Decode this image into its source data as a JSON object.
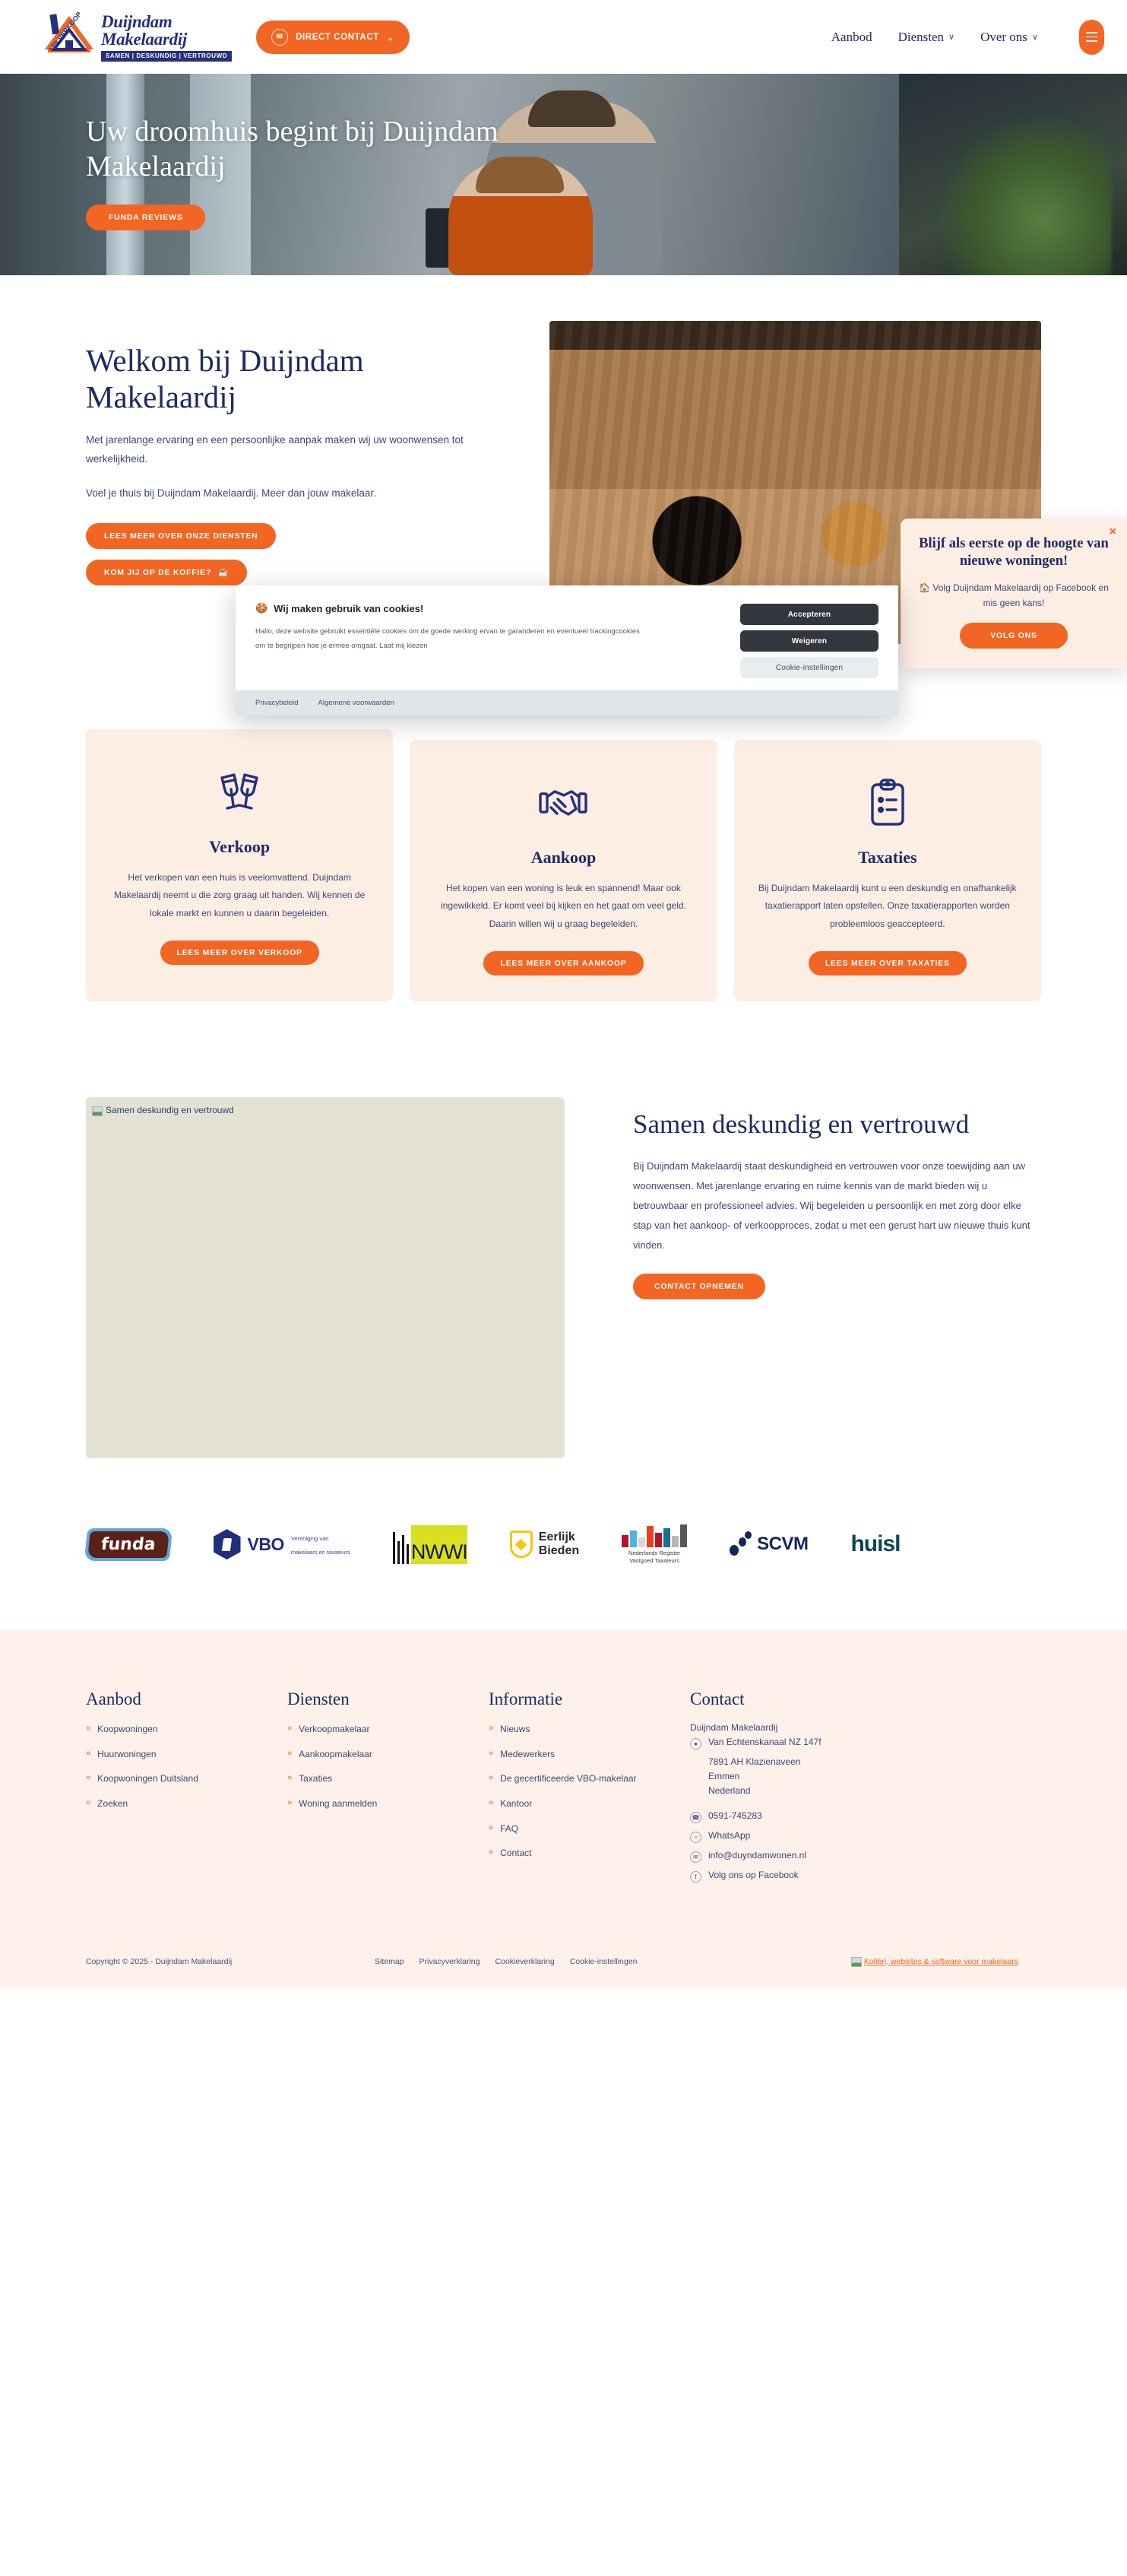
{
  "header": {
    "logo": {
      "line1": "Duijndam",
      "line2": "Makelaardij",
      "tagline": "SAMEN  |  DESKUNDIG  |  VERTROUWD",
      "badge": "UW VERKOOP"
    },
    "direct_contact": "DIRECT CONTACT",
    "direct_contact_icon": "envelope-icon",
    "nav": [
      {
        "label": "Aanbod",
        "caret": ""
      },
      {
        "label": "Diensten",
        "caret": "∨"
      },
      {
        "label": "Over ons",
        "caret": "∨"
      }
    ],
    "menu_icon": "hamburger-menu-icon"
  },
  "hero": {
    "title": "Uw droomhuis begint bij Duijndam Makelaardij",
    "cta": "FUNDA REVIEWS"
  },
  "welkom": {
    "title": "Welkom bij Duijndam Makelaardij",
    "paragraph1": "Met jarenlange ervaring en een persoonlijke aanpak maken wij uw woonwensen tot werkelijkheid.",
    "paragraph2": "Voel je thuis bij Duijndam Makelaardij. Meer dan jouw makelaar.",
    "btn_diensten": "LEES MEER OVER ONZE DIENSTEN",
    "btn_koffie": "KOM JIJ OP DE KOFFIE?",
    "btn_koffie_icon": "coffee-cup-icon"
  },
  "cookie": {
    "icon": "cookie-icon",
    "title": "Wij maken gebruik van cookies!",
    "body": "Hallo, deze website gebruikt essentiële cookies om de goede werking ervan te garanderen en eventueel trackingcookies om te begrijpen hoe je ermee omgaat. Laat mij kiezen",
    "accept": "Accepteren",
    "refuse": "Weigeren",
    "settings": "Cookie-instellingen",
    "links": [
      "Privacybeleid",
      "Algemene voorwaarden"
    ]
  },
  "fbpop": {
    "close_icon": "close-icon",
    "title": "Blijf als eerste op de hoogte van nieuwe woningen!",
    "house_icon": "house-icon",
    "body": "Volg Duijndam Makelaardij op Facebook en mis geen kans!",
    "cta": "VOLG ONS"
  },
  "cards": [
    {
      "icon": "champagne-glasses-icon",
      "title": "Verkoop",
      "body": "Het verkopen van een huis is veelomvattend. Duijndam Makelaardij neemt u die zorg graag uit handen. Wij kennen de lokale markt en kunnen u daarin begeleiden.",
      "cta": "LEES MEER OVER VERKOOP"
    },
    {
      "icon": "handshake-icon",
      "title": "Aankoop",
      "body": "Het kopen van een woning is leuk en spannend! Maar ook ingewikkeld. Er komt veel bij kijken en het gaat om veel geld. Daarin willen wij u graag begeleiden.",
      "cta": "LEES MEER OVER AANKOOP"
    },
    {
      "icon": "clipboard-list-icon",
      "title": "Taxaties",
      "body": "Bij Duijndam Makelaardij kunt u een deskundig en onafhankelijk taxatierapport laten opstellen. Onze taxatierapporten worden probleemloos geaccepteerd.",
      "cta": "LEES MEER OVER TAXATIES"
    }
  ],
  "samen": {
    "image_alt": "Samen deskundig en vertrouwd",
    "title": "Samen deskundig en vertrouwd",
    "body": "Bij Duijndam Makelaardij staat deskundigheid en vertrouwen voor onze toewijding aan uw woonwensen. Met jarenlange ervaring en ruime kennis van de markt bieden wij u betrouwbaar en professioneel advies. Wij begeleiden u persoonlijk en met zorg door elke stap van het aankoop- of verkoopproces, zodat u met een gerust hart uw nieuwe thuis kunt vinden.",
    "cta": "CONTACT OPNEMEN"
  },
  "partners": [
    {
      "name": "funda",
      "label": "funda"
    },
    {
      "name": "vbo",
      "label": "VBO",
      "sub1": "Vereniging van",
      "sub2": "makelaars en taxateurs"
    },
    {
      "name": "nwwi",
      "label": "NWWI"
    },
    {
      "name": "eerlijk-bieden",
      "line1": "Eerlijk",
      "line2": "Bieden"
    },
    {
      "name": "nrvt",
      "line1": "Nederlands Register",
      "line2": "Vastgoed  Taxateurs"
    },
    {
      "name": "scvm",
      "label": "SCVM"
    },
    {
      "name": "huislijn",
      "label": "huisl"
    }
  ],
  "footer": {
    "columns": [
      {
        "title": "Aanbod",
        "items": [
          "Koopwoningen",
          "Huurwoningen",
          "Koopwoningen Duitsland",
          "Zoeken"
        ]
      },
      {
        "title": "Diensten",
        "items": [
          "Verkoopmakelaar",
          "Aankoopmakelaar",
          "Taxaties",
          "Woning aanmelden"
        ]
      },
      {
        "title": "Informatie",
        "items": [
          "Nieuws",
          "Medewerkers",
          "De gecertificeerde VBO-makelaar",
          "Kantoor",
          "FAQ",
          "Contact"
        ]
      }
    ],
    "contact": {
      "title": "Contact",
      "company": "Duijndam Makelaardij",
      "address_line1": "Van Echtenskanaal NZ 147f",
      "address_line2": "7891 AH Klazienaveen",
      "address_line3": "Emmen",
      "address_line4": "Nederland",
      "phone": "0591-745283",
      "whatsapp": "WhatsApp",
      "email": "info@duyndamwonen.nl",
      "facebook": "Volg ons op Facebook",
      "icons": {
        "address": "map-pin-icon",
        "phone": "phone-icon",
        "whatsapp": "whatsapp-icon",
        "email": "envelope-icon",
        "facebook": "facebook-icon"
      }
    },
    "copyright": "Copyright © 2025 - Duijndam Makelaardij",
    "bottom_links": [
      "Sitemap",
      "Privacyverklaring",
      "Cookieverklaring",
      "Cookie-instellingen"
    ],
    "credit": "Kolibri, websites & software voor makelaars"
  },
  "colors": {
    "accent": "#f26522",
    "navy": "#1e2a63",
    "card_bg": "#fdeee4",
    "footer_bg": "#fdf1e9"
  }
}
